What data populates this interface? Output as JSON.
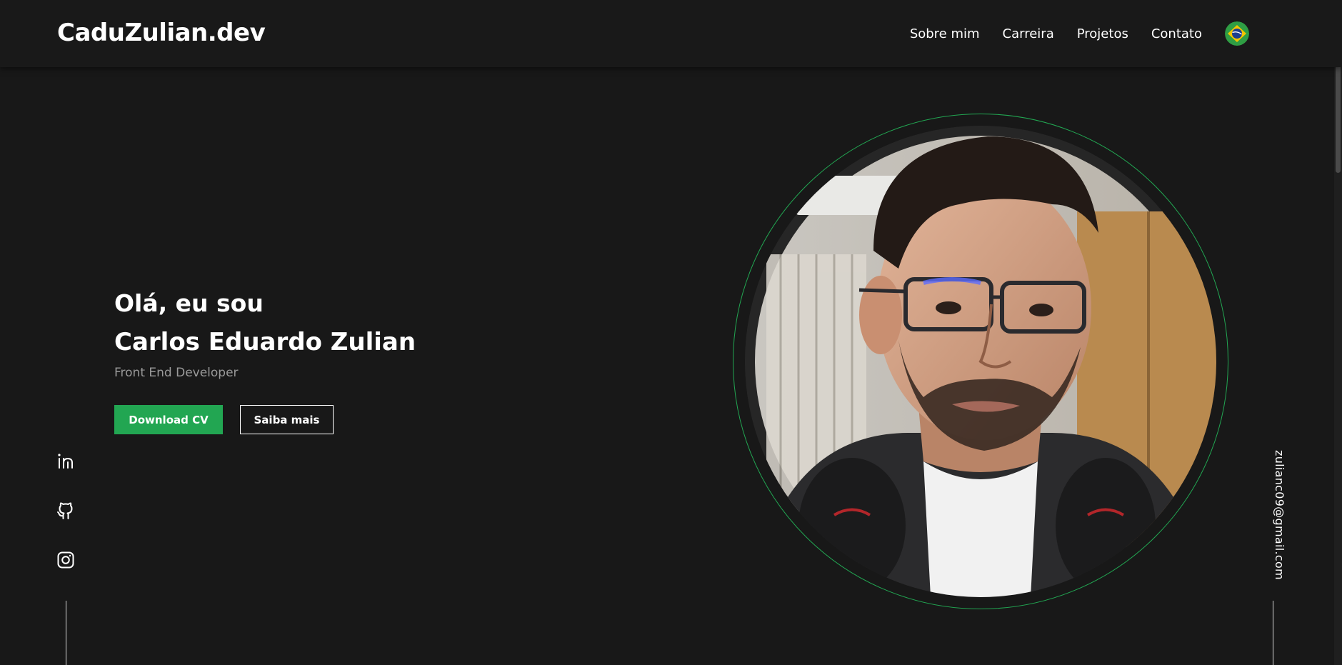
{
  "header": {
    "logo": "CaduZulian.dev",
    "nav": [
      "Sobre mim",
      "Carreira",
      "Projetos",
      "Contato"
    ],
    "language_icon": "brazil-flag-icon"
  },
  "hero": {
    "greeting": "Olá, eu sou",
    "name": "Carlos Eduardo Zulian",
    "role": "Front End Developer",
    "download_label": "Download CV",
    "more_label": "Saiba mais"
  },
  "social": {
    "icons": [
      "linkedin-icon",
      "github-icon",
      "instagram-icon"
    ]
  },
  "contact": {
    "email": "zulianc09@gmail.com"
  },
  "colors": {
    "background": "#181818",
    "header": "#191919",
    "accent": "#22a652",
    "muted_text": "#9a9a9a"
  }
}
